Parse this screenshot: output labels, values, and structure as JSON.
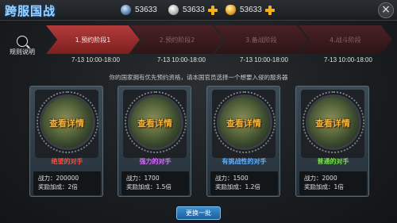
{
  "header": {
    "title": "跨服国战",
    "resources": [
      {
        "icon": "gem-coin-icon",
        "value": "53633"
      },
      {
        "icon": "silver-coin-icon",
        "value": "53633"
      },
      {
        "icon": "gold-ingot-icon",
        "value": "53633"
      }
    ],
    "close_glyph": "×"
  },
  "rules_label": "规则说明",
  "stages": [
    {
      "label": "1.预约阶段1",
      "date": "7-13 10:00-18:00",
      "active": true
    },
    {
      "label": "2.预约阶段2",
      "date": "7-13 10:00-18:00",
      "active": false
    },
    {
      "label": "3.备战阶段",
      "date": "7-13 10:00-18:00",
      "active": false
    },
    {
      "label": "4.战斗阶段",
      "date": "7-13 10:00-18:00",
      "active": false
    }
  ],
  "notice": "你的国家拥有优先预约资格，请本国官员选择一个想要入侵的服务器",
  "cards": [
    {
      "detail": "查看详情",
      "tag": "绝望的对手",
      "tag_color": "#ff4a3a",
      "power": "战力：200000",
      "bonus": "奖励加成：2倍"
    },
    {
      "detail": "查看详情",
      "tag": "强力的对手",
      "tag_color": "#d86cff",
      "power": "战力：1700",
      "bonus": "奖励加成：1.5倍"
    },
    {
      "detail": "查看详情",
      "tag": "有挑战性的对手",
      "tag_color": "#5fb0ff",
      "power": "战力：1500",
      "bonus": "奖励加成：1.2倍"
    },
    {
      "detail": "查看详情",
      "tag": "普通的对手",
      "tag_color": "#7be04a",
      "power": "战力：2000",
      "bonus": "奖励加成：1倍"
    }
  ],
  "refresh_label": "更换一批"
}
